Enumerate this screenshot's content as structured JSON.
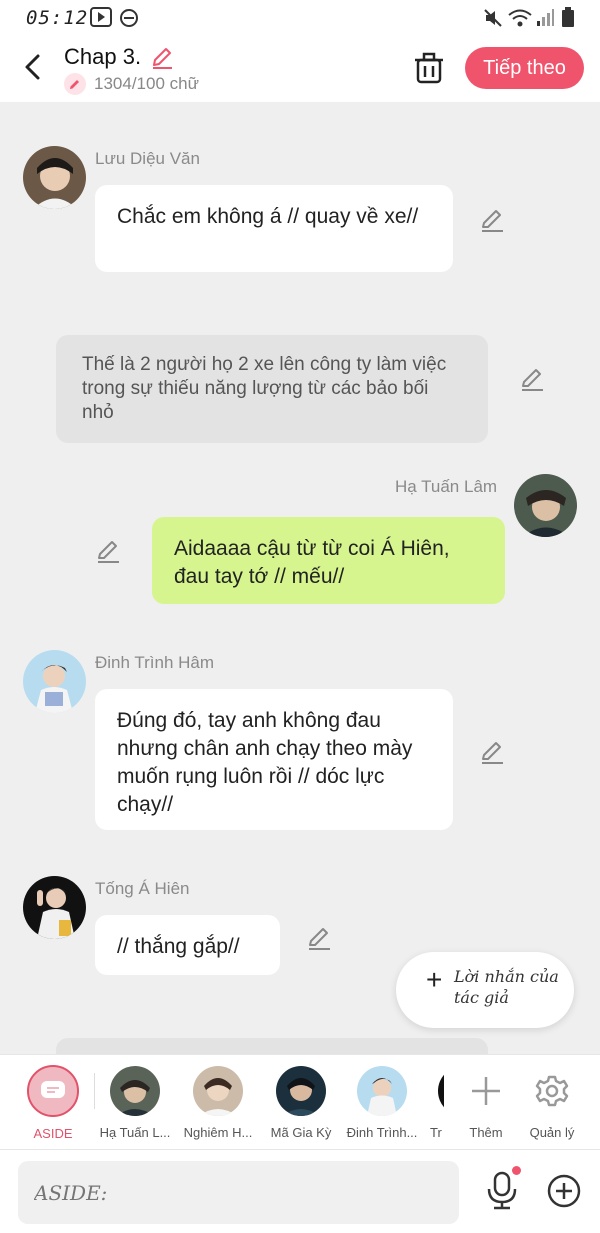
{
  "status": {
    "time": "05:12"
  },
  "header": {
    "title": "Chap 3.",
    "word_count": "1304/100 chữ",
    "next_label": "Tiếp theo"
  },
  "messages": [
    {
      "type": "left",
      "name": "Lưu Diệu Văn",
      "text": "Chắc em không á // quay về xe//"
    },
    {
      "type": "narration",
      "text": "Thế là 2 người họ 2 xe lên công ty làm việc trong sự thiếu năng lượng từ các bảo bối nhỏ"
    },
    {
      "type": "right",
      "name": "Hạ Tuấn Lâm",
      "text": "Aidaaaa cậu từ từ coi Á Hiên, đau tay tớ // mếu//"
    },
    {
      "type": "left",
      "name": "Đinh Trình Hâm",
      "text": "Đúng đó, tay anh không đau nhưng chân anh chạy theo mày muốn rụng luôn rồi // dóc lực chạy//"
    },
    {
      "type": "left",
      "name": "Tống Á Hiên",
      "text": "// thắng gắp//"
    }
  ],
  "author_note": {
    "label": "Lời nhắn của tác giả"
  },
  "characters": [
    {
      "name": "ASIDE"
    },
    {
      "name": "Hạ Tuấn L..."
    },
    {
      "name": "Nghiêm H..."
    },
    {
      "name": "Mã Gia Kỳ"
    },
    {
      "name": "Đinh Trình..."
    },
    {
      "name": "Tr"
    }
  ],
  "actions": {
    "more": "Thêm",
    "manage": "Quản lý"
  },
  "input": {
    "placeholder": "ASIDE:"
  },
  "colors": {
    "accent": "#f0546d",
    "green_bubble": "#d6f58e",
    "narration_bg": "#e3e3e3"
  }
}
